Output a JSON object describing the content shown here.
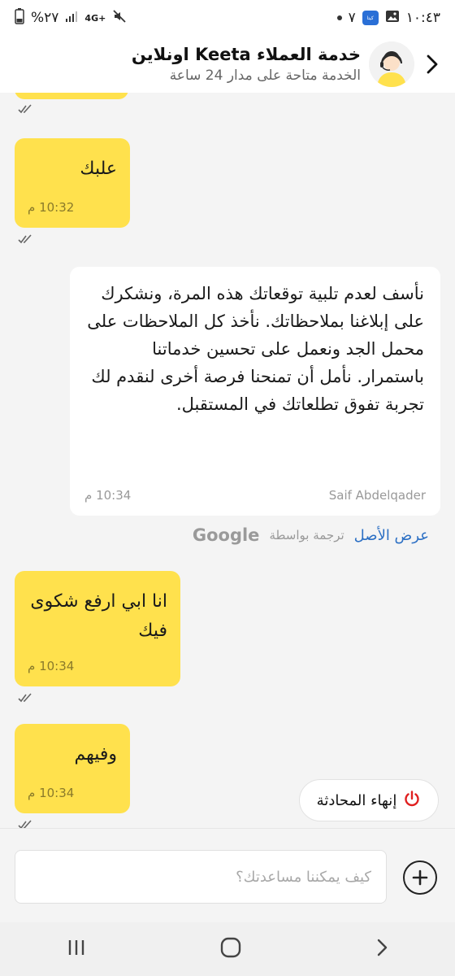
{
  "status_bar": {
    "time": "١٠:٤٣",
    "notification_count": "٧",
    "battery": "%٢٧",
    "network": "4G+",
    "app_badge_text": "كيتا"
  },
  "header": {
    "title": "خدمة العملاء Keeta اونلاين",
    "subtitle": "الخدمة متاحة على مدار 24 ساعة"
  },
  "messages": {
    "m1": {
      "text": "علبك",
      "time": "10:32 م"
    },
    "m2": {
      "text": "نأسف لعدم تلبية توقعاتك هذه المرة، ونشكرك على إبلاغنا بملاحظاتك. نأخذ كل الملاحظات على محمل الجد ونعمل على تحسين خدماتنا باستمرار. نأمل أن تمنحنا فرصة أخرى لنقدم لك تجربة تفوق تطلعاتك في المستقبل.",
      "sender": "Saif Abdelqader",
      "time": "10:34 م"
    },
    "m3": {
      "text": "انا ابي ارفع شكوى فيك",
      "time": "10:34 م"
    },
    "m4": {
      "text": "وفيهم",
      "time": "10:34 م"
    }
  },
  "translation": {
    "show_original": "عرض الأصل",
    "translated_by": "ترجمة بواسطة",
    "provider": "Google"
  },
  "end_chat": {
    "label": "إنهاء المحادثة"
  },
  "composer": {
    "placeholder": "كيف يمكننا مساعدتك؟"
  },
  "colors": {
    "user_bubble": "#ffe14d",
    "end_icon": "#e02020",
    "link": "#2b6fc4"
  }
}
